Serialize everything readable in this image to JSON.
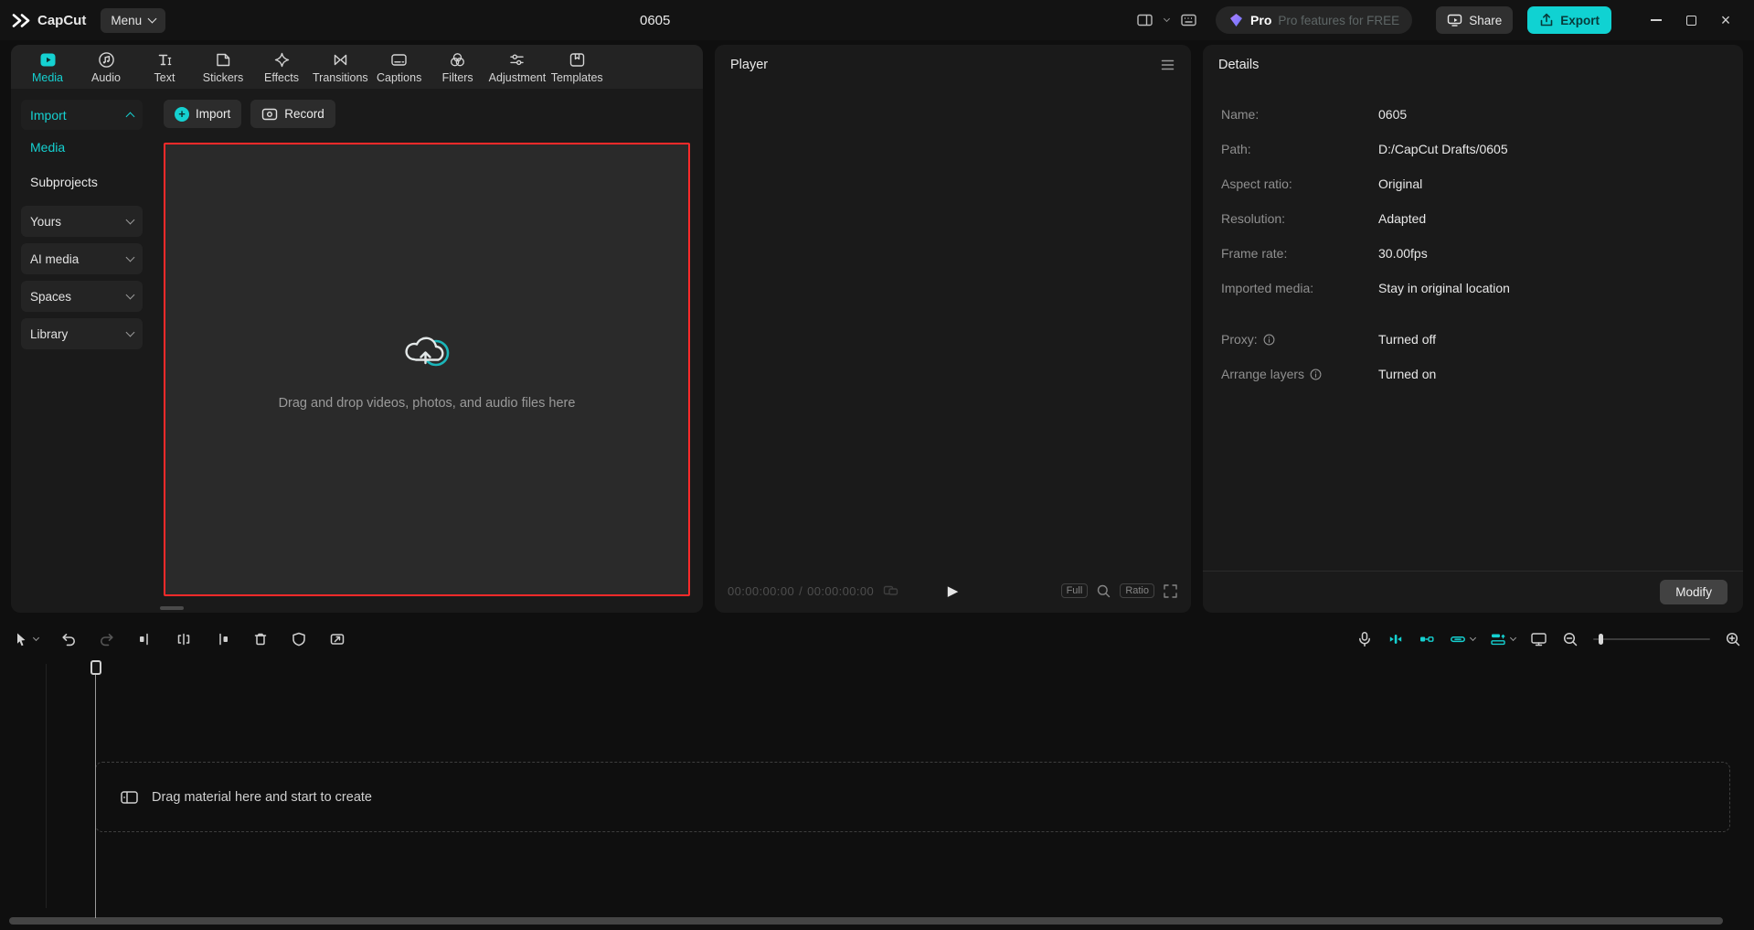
{
  "titlebar": {
    "app_name": "CapCut",
    "menu_label": "Menu",
    "project_title": "0605",
    "pro_badge": "Pro",
    "pro_text": "Pro features for FREE",
    "share_label": "Share",
    "export_label": "Export"
  },
  "glyphs": {
    "play": "▶",
    "plus": "+",
    "close": "×"
  },
  "media_panel": {
    "tabs": [
      {
        "label": "Media"
      },
      {
        "label": "Audio"
      },
      {
        "label": "Text"
      },
      {
        "label": "Stickers"
      },
      {
        "label": "Effects"
      },
      {
        "label": "Transitions"
      },
      {
        "label": "Captions"
      },
      {
        "label": "Filters"
      },
      {
        "label": "Adjustment"
      },
      {
        "label": "Templates"
      }
    ],
    "active_tab": "Media",
    "sidebar": {
      "import_label": "Import",
      "media_label": "Media",
      "subprojects_label": "Subprojects",
      "groups": [
        {
          "label": "Yours"
        },
        {
          "label": "AI media"
        },
        {
          "label": "Spaces"
        },
        {
          "label": "Library"
        }
      ]
    },
    "import_button": "Import",
    "record_button": "Record",
    "dropzone_hint": "Drag and drop videos, photos, and audio files here"
  },
  "player_panel": {
    "title": "Player",
    "current_time": "00:00:00:00",
    "time_separator": "/",
    "total_time": "00:00:00:00",
    "full_label": "Full",
    "ratio_label": "Ratio"
  },
  "details_panel": {
    "title": "Details",
    "fields": [
      {
        "label": "Name:",
        "value": "0605"
      },
      {
        "label": "Path:",
        "value": "D:/CapCut Drafts/0605"
      },
      {
        "label": "Aspect ratio:",
        "value": "Original"
      },
      {
        "label": "Resolution:",
        "value": "Adapted"
      },
      {
        "label": "Frame rate:",
        "value": "30.00fps"
      },
      {
        "label": "Imported media:",
        "value": "Stay in original location"
      }
    ],
    "proxy_label": "Proxy:",
    "proxy_value": "Turned off",
    "arrange_label": "Arrange layers",
    "arrange_value": "Turned on",
    "modify_button": "Modify"
  },
  "timeline": {
    "empty_hint": "Drag material here and start to create"
  },
  "colors": {
    "accent": "#15d1d1",
    "highlight_red": "#fe2a2a",
    "pro_purple": "#8a63f2"
  }
}
